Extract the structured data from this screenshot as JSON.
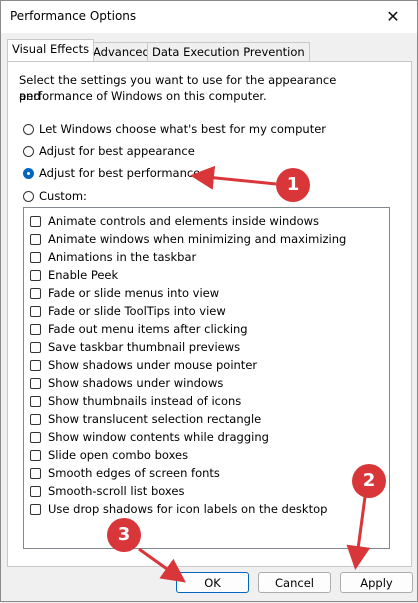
{
  "window": {
    "title": "Performance Options",
    "close_glyph": "✕"
  },
  "tabs": [
    {
      "label": "Visual Effects",
      "active": true
    },
    {
      "label": "Advanced",
      "active": false
    },
    {
      "label": "Data Execution Prevention",
      "active": false
    }
  ],
  "description": {
    "line1": "Select the settings you want to use for the appearance and",
    "line2": "performance of Windows on this computer."
  },
  "radios": [
    {
      "label": "Let Windows choose what's best for my computer",
      "checked": false
    },
    {
      "label": "Adjust for best appearance",
      "checked": false
    },
    {
      "label": "Adjust for best performance",
      "checked": true
    },
    {
      "label": "Custom:",
      "checked": false
    }
  ],
  "effects": [
    {
      "label": "Animate controls and elements inside windows",
      "checked": false
    },
    {
      "label": "Animate windows when minimizing and maximizing",
      "checked": false
    },
    {
      "label": "Animations in the taskbar",
      "checked": false
    },
    {
      "label": "Enable Peek",
      "checked": false
    },
    {
      "label": "Fade or slide menus into view",
      "checked": false
    },
    {
      "label": "Fade or slide ToolTips into view",
      "checked": false
    },
    {
      "label": "Fade out menu items after clicking",
      "checked": false
    },
    {
      "label": "Save taskbar thumbnail previews",
      "checked": false
    },
    {
      "label": "Show shadows under mouse pointer",
      "checked": false
    },
    {
      "label": "Show shadows under windows",
      "checked": false
    },
    {
      "label": "Show thumbnails instead of icons",
      "checked": false
    },
    {
      "label": "Show translucent selection rectangle",
      "checked": false
    },
    {
      "label": "Show window contents while dragging",
      "checked": false
    },
    {
      "label": "Slide open combo boxes",
      "checked": false
    },
    {
      "label": "Smooth edges of screen fonts",
      "checked": false
    },
    {
      "label": "Smooth-scroll list boxes",
      "checked": false
    },
    {
      "label": "Use drop shadows for icon labels on the desktop",
      "checked": false
    }
  ],
  "buttons": {
    "ok": "OK",
    "cancel": "Cancel",
    "apply": "Apply"
  },
  "annotations": {
    "marker1": "1",
    "marker2": "2",
    "marker3": "3",
    "color": "#d9363a"
  }
}
